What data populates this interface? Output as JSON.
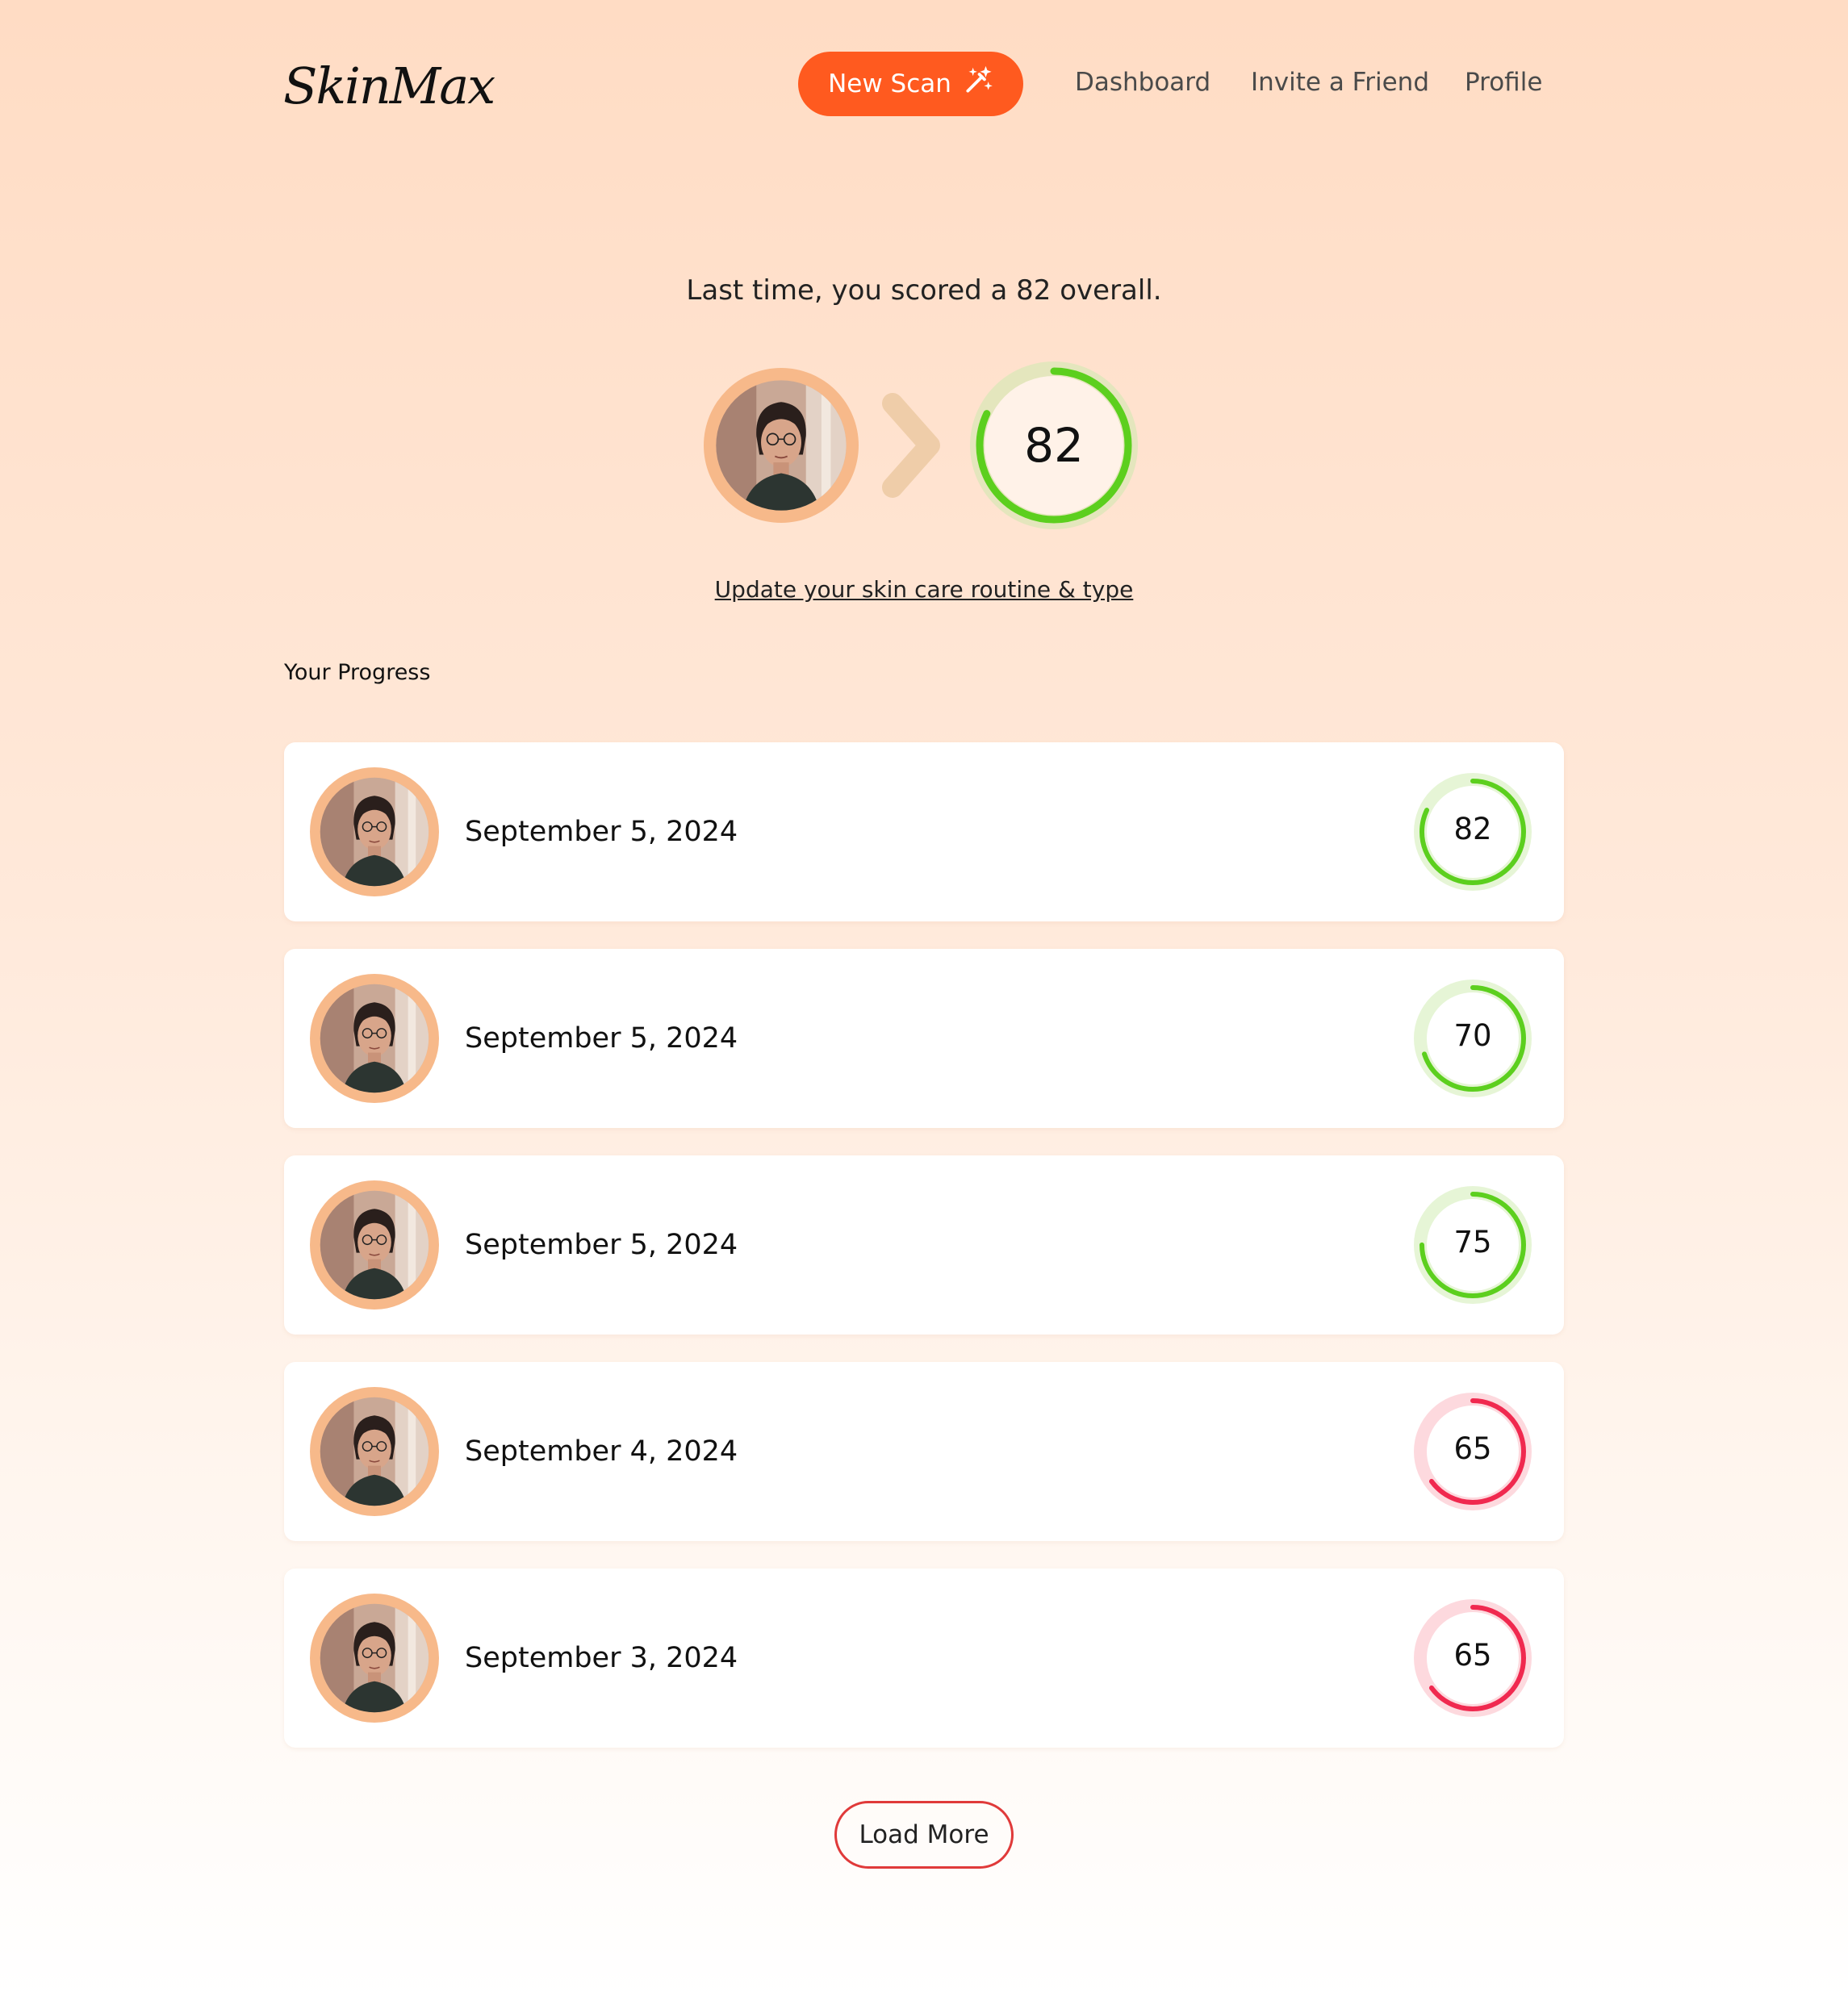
{
  "header": {
    "logo": "SkinMax",
    "new_scan_label": "New Scan",
    "new_scan_icon": "magic-wand-icon",
    "nav": [
      "Dashboard",
      "Invite a Friend",
      "Profile"
    ]
  },
  "hero": {
    "message": "Last time, you scored a 82 overall.",
    "score": 82,
    "score_display": "82",
    "update_link": "Update your skin care routine & type"
  },
  "progress": {
    "title": "Your Progress",
    "items": [
      {
        "date": "September 5, 2024",
        "score": 82,
        "score_display": "82",
        "status": "good"
      },
      {
        "date": "September 5, 2024",
        "score": 70,
        "score_display": "70",
        "status": "good"
      },
      {
        "date": "September 5, 2024",
        "score": 75,
        "score_display": "75",
        "status": "good"
      },
      {
        "date": "September 4, 2024",
        "score": 65,
        "score_display": "65",
        "status": "low"
      },
      {
        "date": "September 3, 2024",
        "score": 65,
        "score_display": "65",
        "status": "low"
      }
    ]
  },
  "load_more_label": "Load More",
  "colors": {
    "accent": "#ff5a1f",
    "good_ring": "#5ccf1e",
    "good_track": "#e6f5d6",
    "low_ring": "#f0294f",
    "low_track": "#fdd9de",
    "avatar_ring": "#f7b98a",
    "load_more_border": "#e03a3a"
  }
}
